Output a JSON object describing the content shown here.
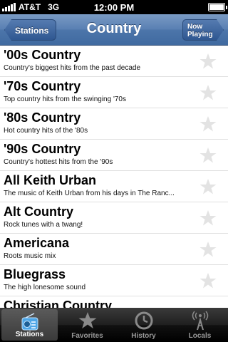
{
  "status_bar": {
    "carrier": "AT&T",
    "network": "3G",
    "time": "12:00 PM"
  },
  "nav": {
    "back_label": "Stations",
    "title": "Country",
    "now_playing_line1": "Now",
    "now_playing_line2": "Playing"
  },
  "stations": [
    {
      "title": "'00s Country",
      "subtitle": "Country's biggest hits from the past decade"
    },
    {
      "title": "'70s Country",
      "subtitle": "Top country hits from the swinging '70s"
    },
    {
      "title": "'80s Country",
      "subtitle": "Hot country hits of the '80s"
    },
    {
      "title": "'90s Country",
      "subtitle": "Country's hottest hits from the '90s"
    },
    {
      "title": "All Keith Urban",
      "subtitle": "The music of Keith Urban from his days in The Ranc..."
    },
    {
      "title": "Alt Country",
      "subtitle": "Rock tunes with a twang!"
    },
    {
      "title": "Americana",
      "subtitle": "Roots music mix"
    },
    {
      "title": "Bluegrass",
      "subtitle": "The high lonesome sound"
    },
    {
      "title": "Christian Country",
      "subtitle": ""
    }
  ],
  "tabs": [
    {
      "label": "Stations",
      "icon": "radio-icon",
      "active": true
    },
    {
      "label": "Favorites",
      "icon": "star-icon",
      "active": false
    },
    {
      "label": "History",
      "icon": "clock-icon",
      "active": false
    },
    {
      "label": "Locals",
      "icon": "antenna-icon",
      "active": false
    }
  ],
  "colors": {
    "nav_bar": "#5a80b3",
    "tab_bar": "#1f1f1f",
    "star": "#e3e3e3"
  }
}
